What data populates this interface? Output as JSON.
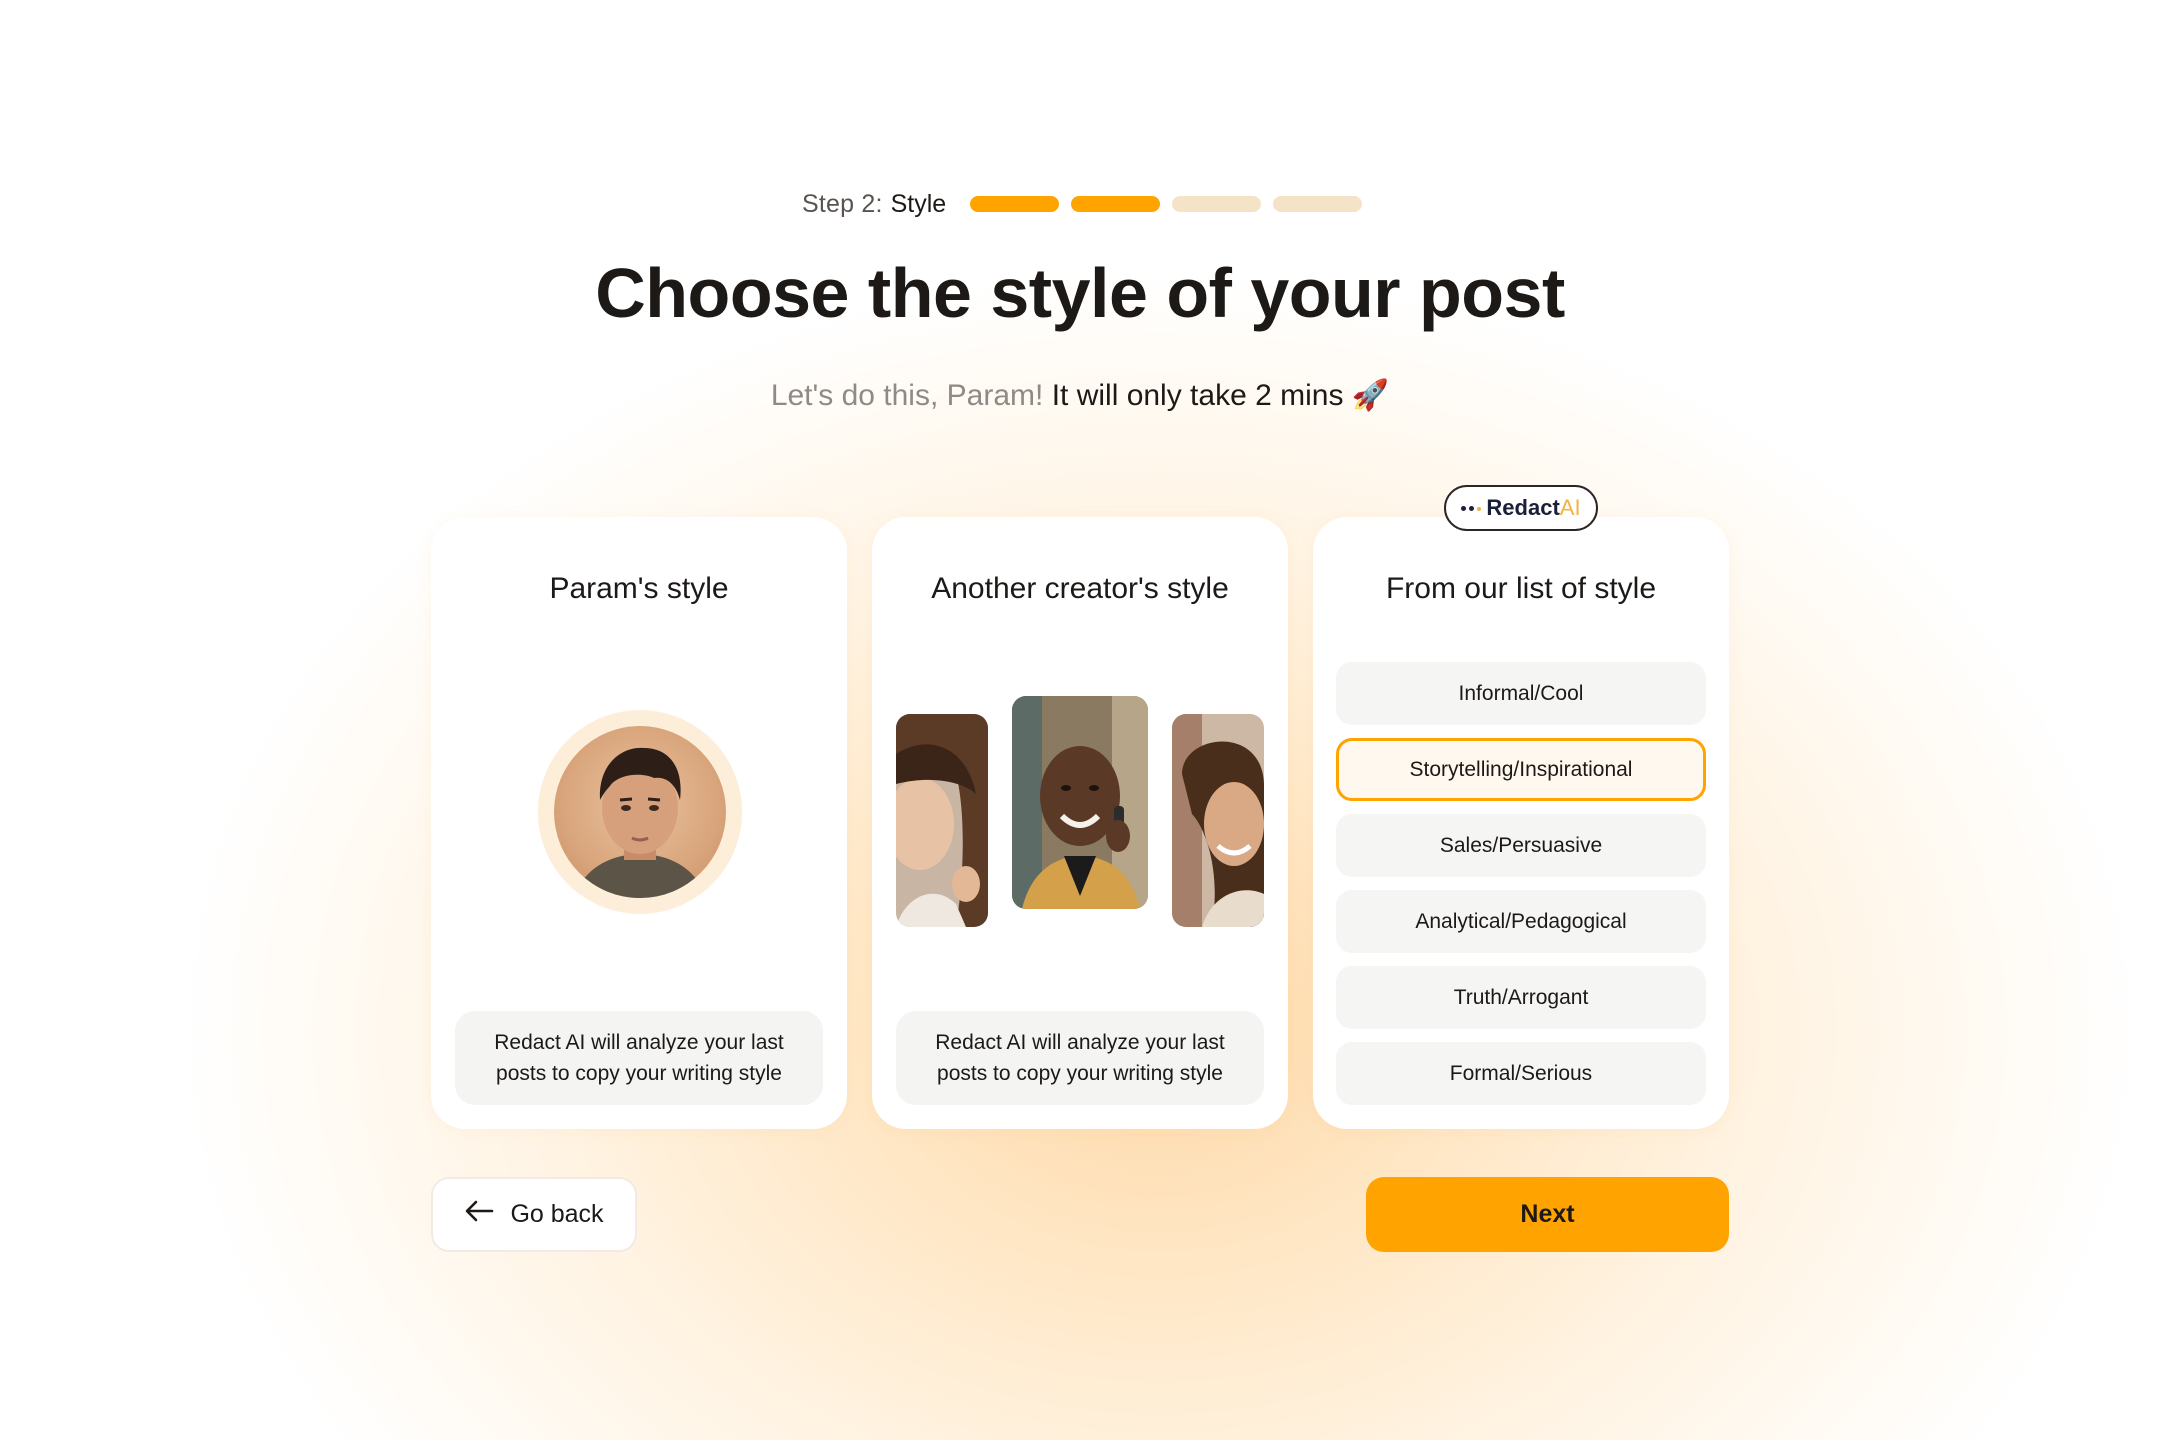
{
  "header": {
    "step_label": "Step 2:",
    "step_name": "Style",
    "progress": {
      "total_steps": 4,
      "completed_steps": 2,
      "active_color": "#ffa300",
      "inactive_color": "#f5e3c8"
    },
    "title": "Choose the style of your post",
    "subtitle_muted": "Let's do this, Param!",
    "subtitle_strong": "It will only take 2 mins",
    "subtitle_emoji": "🚀"
  },
  "cards": {
    "own": {
      "title": "Param's style",
      "note": "Redact AI will analyze your last posts to copy your writing style"
    },
    "creator": {
      "title": "Another creator's style",
      "note": "Redact AI will analyze your last posts to copy your writing style"
    },
    "list": {
      "title": "From our list of style",
      "badge_main": "Redact",
      "badge_suffix": "AI",
      "styles": [
        {
          "label": "Informal/Cool",
          "selected": false
        },
        {
          "label": "Storytelling/Inspirational",
          "selected": true
        },
        {
          "label": "Sales/Persuasive",
          "selected": false
        },
        {
          "label": "Analytical/Pedagogical",
          "selected": false
        },
        {
          "label": "Truth/Arrogant",
          "selected": false
        },
        {
          "label": "Formal/Serious",
          "selected": false
        }
      ]
    }
  },
  "footer": {
    "back_label": "Go back",
    "next_label": "Next",
    "accent": "#ffa300"
  }
}
